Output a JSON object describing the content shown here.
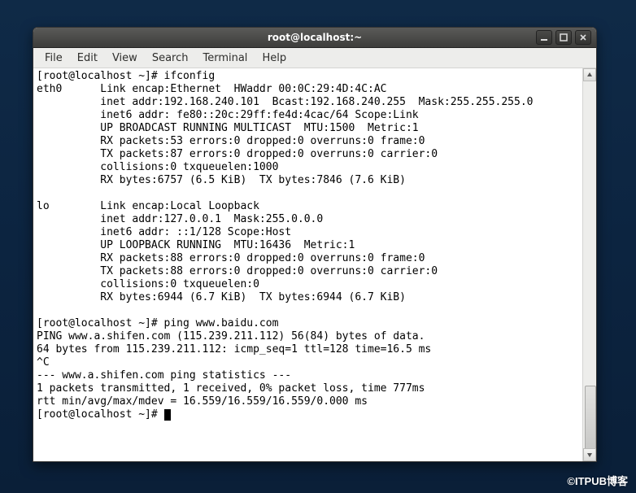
{
  "window": {
    "title": "root@localhost:~"
  },
  "menu": {
    "file": "File",
    "edit": "Edit",
    "view": "View",
    "search": "Search",
    "terminal": "Terminal",
    "help": "Help"
  },
  "terminal": {
    "lines": [
      "[root@localhost ~]# ifconfig",
      "eth0      Link encap:Ethernet  HWaddr 00:0C:29:4D:4C:AC",
      "          inet addr:192.168.240.101  Bcast:192.168.240.255  Mask:255.255.255.0",
      "          inet6 addr: fe80::20c:29ff:fe4d:4cac/64 Scope:Link",
      "          UP BROADCAST RUNNING MULTICAST  MTU:1500  Metric:1",
      "          RX packets:53 errors:0 dropped:0 overruns:0 frame:0",
      "          TX packets:87 errors:0 dropped:0 overruns:0 carrier:0",
      "          collisions:0 txqueuelen:1000",
      "          RX bytes:6757 (6.5 KiB)  TX bytes:7846 (7.6 KiB)",
      "",
      "lo        Link encap:Local Loopback",
      "          inet addr:127.0.0.1  Mask:255.0.0.0",
      "          inet6 addr: ::1/128 Scope:Host",
      "          UP LOOPBACK RUNNING  MTU:16436  Metric:1",
      "          RX packets:88 errors:0 dropped:0 overruns:0 frame:0",
      "          TX packets:88 errors:0 dropped:0 overruns:0 carrier:0",
      "          collisions:0 txqueuelen:0",
      "          RX bytes:6944 (6.7 KiB)  TX bytes:6944 (6.7 KiB)",
      "",
      "[root@localhost ~]# ping www.baidu.com",
      "PING www.a.shifen.com (115.239.211.112) 56(84) bytes of data.",
      "64 bytes from 115.239.211.112: icmp_seq=1 ttl=128 time=16.5 ms",
      "^C",
      "--- www.a.shifen.com ping statistics ---",
      "1 packets transmitted, 1 received, 0% packet loss, time 777ms",
      "rtt min/avg/max/mdev = 16.559/16.559/16.559/0.000 ms"
    ],
    "prompt": "[root@localhost ~]# "
  },
  "watermark": "©ITPUB博客"
}
